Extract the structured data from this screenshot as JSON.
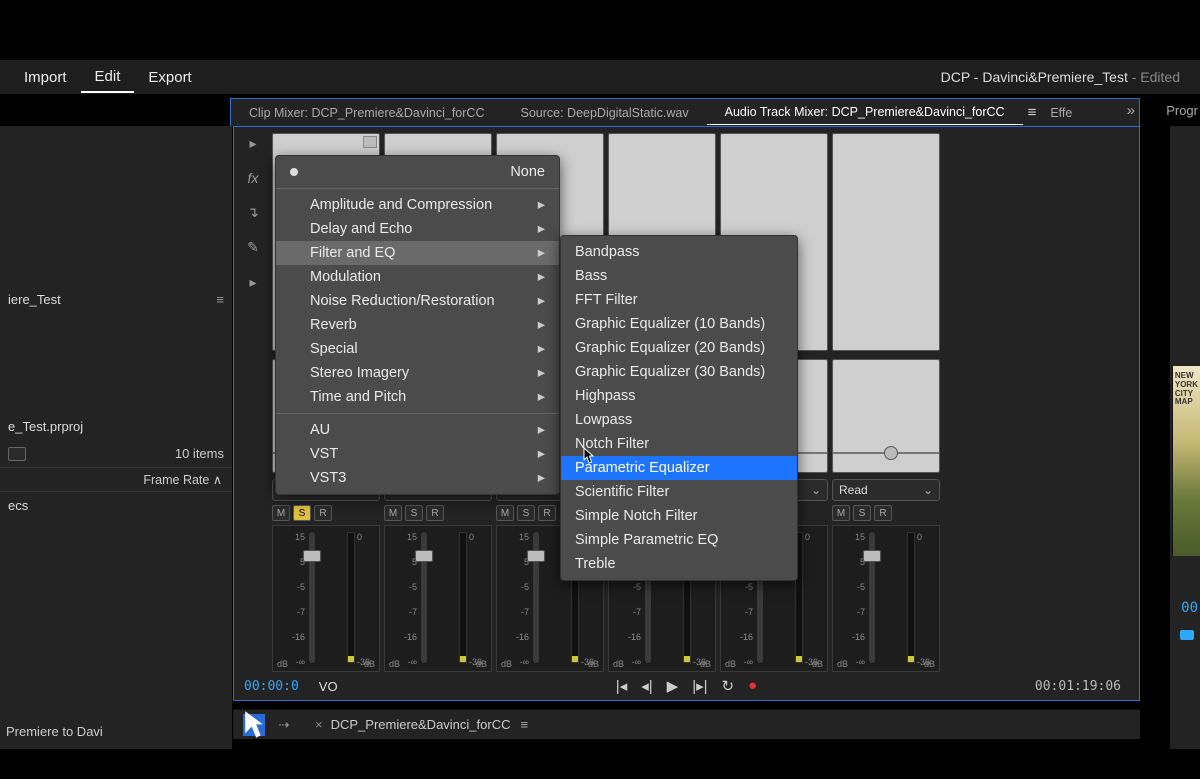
{
  "menubar": {
    "import": "Import",
    "edit": "Edit",
    "export": "Export"
  },
  "project_title": {
    "main": "DCP - Davinci&Premiere_Test",
    "suffix": " - Edited"
  },
  "tabs": {
    "clip_mixer": "Clip Mixer: DCP_Premiere&Davinci_forCC",
    "source": "Source: DeepDigitalStatic.wav",
    "track_mixer": "Audio Track Mixer: DCP_Premiere&Davinci_forCC",
    "effects_short": "Effe",
    "program_short": "Progr"
  },
  "left": {
    "bin": "iere_Test",
    "project_file": "e_Test.prproj",
    "item_count": "10 items",
    "column": "Frame Rate",
    "row1": "ecs",
    "bottom": "Premiere to Davi"
  },
  "mixer": {
    "read": "Read",
    "btn_m": "M",
    "btn_s": "S",
    "btn_r": "R",
    "db_label": "dB",
    "ticks": [
      "15",
      "5",
      "-5",
      "-7",
      "-16",
      "-∞"
    ],
    "meter_ticks": [
      "0",
      "-36"
    ],
    "track_name": "VO",
    "tc_left": "00:00:0",
    "tc_right": "00:01:19:06"
  },
  "seq": {
    "name": "DCP_Premiere&Davinci_forCC"
  },
  "right": {
    "poster_lines": [
      "NEW",
      "YORK",
      "CITY",
      "MAP"
    ],
    "tc": "00"
  },
  "menu_main": {
    "none": "None",
    "items": [
      "Amplitude and Compression",
      "Delay and Echo",
      "Filter and EQ",
      "Modulation",
      "Noise Reduction/Restoration",
      "Reverb",
      "Special",
      "Stereo Imagery",
      "Time and Pitch"
    ],
    "plugins": [
      "AU",
      "VST",
      "VST3"
    ]
  },
  "menu_sub": {
    "items": [
      "Bandpass",
      "Bass",
      "FFT Filter",
      "Graphic Equalizer (10 Bands)",
      "Graphic Equalizer (20 Bands)",
      "Graphic Equalizer (30 Bands)",
      "Highpass",
      "Lowpass",
      "Notch Filter",
      "Parametric Equalizer",
      "Scientific Filter",
      "Simple Notch Filter",
      "Simple Parametric EQ",
      "Treble"
    ],
    "highlight_index": 9
  }
}
